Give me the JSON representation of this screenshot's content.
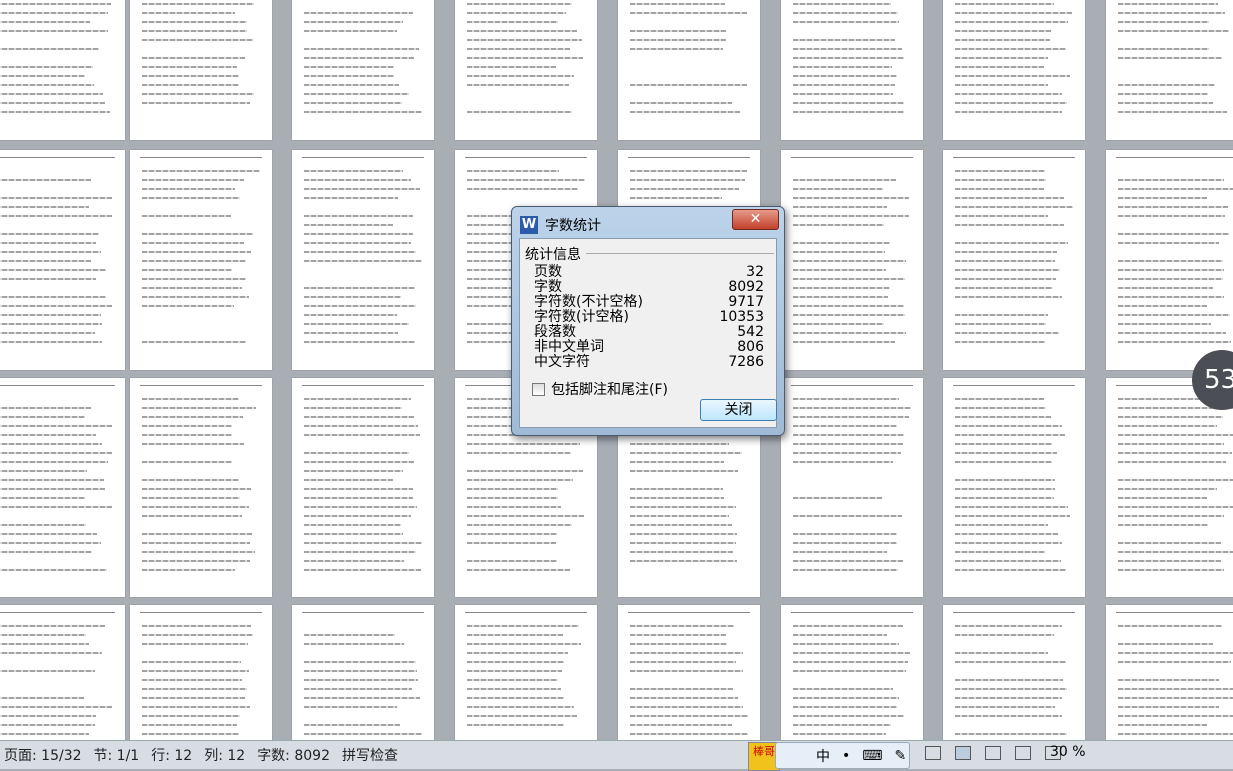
{
  "dialog": {
    "title": "字数统计",
    "close_glyph": "✕",
    "group_label": "统计信息",
    "stats": [
      {
        "label": "页数",
        "value": "32"
      },
      {
        "label": "字数",
        "value": "8092"
      },
      {
        "label": "字符数(不计空格)",
        "value": "9717"
      },
      {
        "label": "字符数(计空格)",
        "value": "10353"
      },
      {
        "label": "段落数",
        "value": "542"
      },
      {
        "label": "非中文单词",
        "value": "806"
      },
      {
        "label": "中文字符",
        "value": "7286"
      }
    ],
    "checkbox_label": "包括脚注和尾注(F)",
    "checkbox_checked": false,
    "close_button": "关闭"
  },
  "status": {
    "page": "页面: 15/32",
    "section": "节: 1/1",
    "line": "行: 12",
    "col": "列: 12",
    "words": "字数: 8092",
    "spell": "拼写检查",
    "zoom": "30 %"
  },
  "ime": {
    "mode": "中",
    "mascot": "棒哥"
  },
  "page_indicator": "53"
}
